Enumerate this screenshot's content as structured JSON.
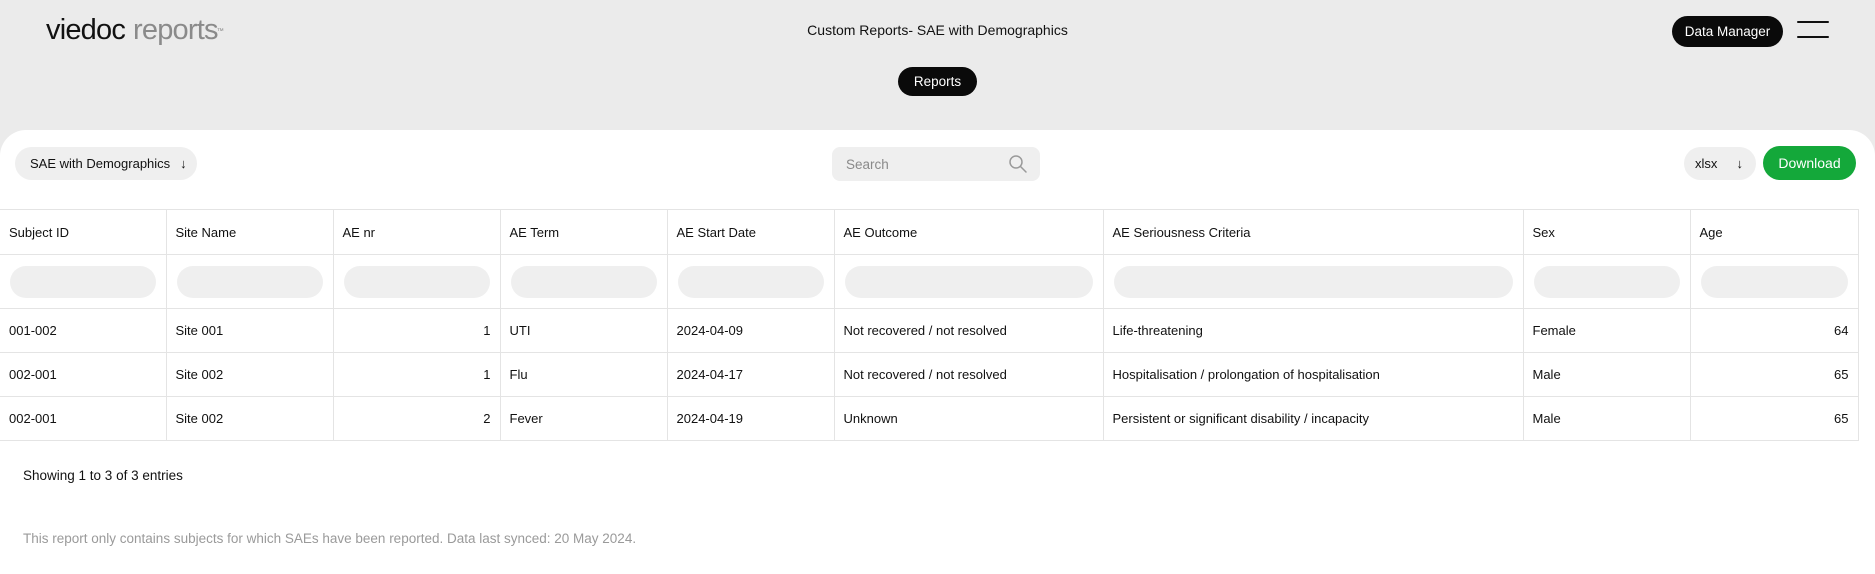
{
  "header": {
    "logo_brand": "viedoc",
    "logo_product": "reports",
    "logo_tm": "™",
    "title": "Custom Reports- SAE with Demographics",
    "role_button": "Data Manager",
    "nav_pill": "Reports"
  },
  "toolbar": {
    "report_select": "SAE with Demographics",
    "search_placeholder": "Search",
    "format_select": "xlsx",
    "download_label": "Download"
  },
  "table": {
    "columns": [
      "Subject ID",
      "Site Name",
      "AE nr",
      "AE Term",
      "AE Start Date",
      "AE Outcome",
      "AE Seriousness Criteria",
      "Sex",
      "Age"
    ],
    "rows": [
      [
        "001-002",
        "Site 001",
        "1",
        "UTI",
        "2024-04-09",
        "Not recovered / not resolved",
        "Life-threatening",
        "Female",
        "64"
      ],
      [
        "002-001",
        "Site 002",
        "1",
        "Flu",
        "2024-04-17",
        "Not recovered / not resolved",
        "Hospitalisation / prolongation of hospitalisation",
        "Male",
        "65"
      ],
      [
        "002-001",
        "Site 002",
        "2",
        "Fever",
        "2024-04-19",
        "Unknown",
        "Persistent or significant disability / incapacity",
        "Male",
        "65"
      ]
    ]
  },
  "footer": {
    "entries": "Showing 1 to 3 of 3 entries",
    "note": "This report only contains subjects for which SAEs have been reported. Data last synced: 20 May 2024."
  },
  "colors": {
    "background": "#ebebeb",
    "accent_dark": "#0a0a0a",
    "download_green": "#14a83a"
  },
  "icons": {
    "search": "search-icon",
    "menu": "hamburger-menu-icon",
    "dropdown": "arrow-down-icon"
  }
}
